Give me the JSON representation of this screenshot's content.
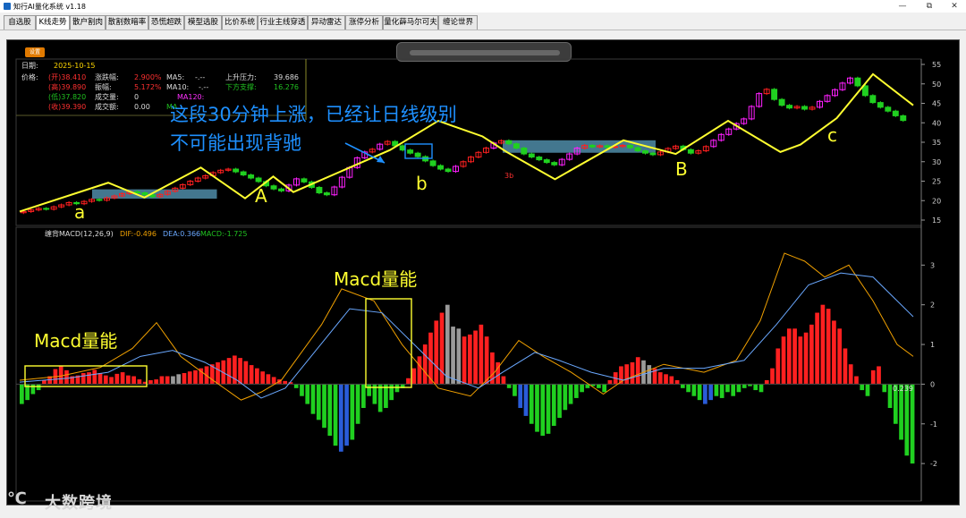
{
  "window": {
    "title": "知行AI量化系统 v1.18",
    "btn_min": "—",
    "btn_max": "⧉",
    "btn_close": "✕"
  },
  "tabs": [
    "自选股",
    "K线走势",
    "散户割肉",
    "散割数暗率",
    "恐慌超跌",
    "模型选股",
    "比价系统",
    "行业主线穿透",
    "异动雷达",
    "涨停分析",
    "量化薛马尔可夫",
    "缠论世界"
  ],
  "toolbar": {
    "settings_label": "设置"
  },
  "info": {
    "date_label": "日期:",
    "date_value": "2025-10-15",
    "price_label": "价格:",
    "open": "(开)38.410",
    "high": "(高)39.890",
    "low": "(低)37.820",
    "close": "(收)39.390",
    "change_pct_label": "涨跌幅:",
    "change_pct": "2.900%",
    "amplitude_label": "振幅:",
    "amplitude": "5.172%",
    "volume_label": "成交量:",
    "volume": "0",
    "amount_label": "成交额:",
    "amount": "0.00",
    "ma5_label": "MA5:",
    "ma5": "-.--",
    "ma10_label": "MA10:",
    "ma10": "-.--",
    "ma120_label": "MA120:",
    "ma_label": "MA",
    "resistance_label": "上升压力:",
    "resistance": "39.686",
    "support_label": "下方支撑:",
    "support": "16.276"
  },
  "macd_header": {
    "name": "缠背MACD(12,26,9)",
    "dif": "DIF:-0.496",
    "dea": "DEA:0.366",
    "macd": "MACD:-1.725"
  },
  "annotations": {
    "main_text_1": "这段30分钟上涨，已经让日线级别",
    "main_text_2": "不可能出现背驰",
    "label_a": "a",
    "label_A": "A",
    "label_b": "b",
    "label_B": "B",
    "label_c": "c",
    "macd_label_1": "Macd量能",
    "macd_label_2": "Macd量能",
    "zero_value": "0.239",
    "bottom_mark": "3b"
  },
  "price_axis": [
    "55",
    "50",
    "45",
    "40",
    "35",
    "30",
    "25",
    "20",
    "15"
  ],
  "macd_axis": [
    "3",
    "2",
    "1",
    "0",
    "-1",
    "-2"
  ],
  "watermark": {
    "icon": "℃",
    "text": "大数跨境"
  },
  "colors": {
    "up": "#ff2020",
    "down": "#20d020",
    "magenta": "#ff20ff",
    "zigzag": "#ffff30",
    "zone": "#4f8ca8",
    "annot": "#1e90ff",
    "dif": "#f0a000",
    "dea": "#6aa8ff"
  },
  "chart_data": {
    "type": "candlestick+macd",
    "price": {
      "ylim": [
        15,
        55
      ],
      "closes": [
        17.2,
        17.6,
        18.0,
        17.8,
        18.4,
        18.9,
        19.5,
        19.2,
        19.8,
        20.3,
        20.1,
        20.7,
        21.2,
        21.8,
        22.3,
        22.0,
        21.5,
        21.0,
        21.6,
        22.4,
        23.2,
        24.1,
        25.0,
        25.8,
        26.4,
        27.2,
        27.8,
        28.1,
        27.4,
        26.6,
        25.8,
        24.9,
        23.8,
        23.0,
        22.5,
        24.0,
        25.6,
        24.8,
        23.4,
        22.0,
        21.5,
        23.5,
        26.0,
        28.5,
        31.0,
        32.5,
        33.2,
        34.5,
        35.2,
        34.1,
        33.0,
        32.2,
        31.3,
        30.2,
        29.0,
        28.1,
        27.5,
        28.8,
        30.0,
        31.2,
        32.4,
        33.5,
        34.8,
        35.4,
        34.6,
        33.5,
        32.0,
        31.2,
        30.5,
        29.8,
        29.2,
        30.6,
        32.0,
        33.5,
        34.2,
        33.8,
        34.1,
        33.7,
        33.9,
        34.2,
        33.6,
        32.8,
        32.2,
        31.8,
        32.5,
        33.4,
        34.0,
        33.1,
        32.2,
        32.8,
        33.9,
        35.5,
        37.0,
        38.4,
        39.8,
        41.0,
        44.2,
        47.5,
        48.6,
        46.0,
        44.5,
        43.8,
        44.2,
        43.5,
        44.0,
        45.5,
        47.0,
        48.5,
        50.2,
        51.5,
        49.5,
        47.0,
        45.2,
        44.0,
        43.0,
        41.8,
        40.6
      ],
      "zigzag": [
        [
          0,
          17.2
        ],
        [
          22,
          24.6
        ],
        [
          31,
          20.8
        ],
        [
          45,
          28.5
        ],
        [
          56,
          20.6
        ],
        [
          63,
          26.2
        ],
        [
          68,
          22.2
        ],
        [
          92,
          33.0
        ],
        [
          104,
          40.5
        ],
        [
          115,
          36.5
        ],
        [
          121,
          32.5
        ],
        [
          133,
          25.5
        ],
        [
          150,
          35.5
        ],
        [
          163,
          32.0
        ],
        [
          176,
          40.5
        ],
        [
          189,
          32.5
        ],
        [
          194,
          34.4
        ],
        [
          203,
          41.2
        ],
        [
          212,
          52.5
        ],
        [
          222,
          44.5
        ]
      ],
      "zones": [
        {
          "from": 18,
          "to": 49,
          "low": 20.5,
          "high": 22.9
        },
        {
          "from": 120,
          "to": 158,
          "low": 32.3,
          "high": 35.5
        }
      ]
    },
    "macd": {
      "ylim": [
        -2.2,
        3.3
      ],
      "hist": [
        -0.5,
        -0.4,
        -0.25,
        -0.15,
        0.1,
        0.2,
        0.38,
        0.45,
        0.35,
        0.2,
        0.22,
        0.28,
        0.3,
        0.36,
        0.28,
        0.22,
        0.18,
        0.26,
        0.3,
        0.22,
        0.2,
        0.12,
        0.06,
        0.1,
        0.12,
        0.2,
        0.2,
        0.2,
        0.25,
        0.28,
        0.32,
        0.35,
        0.4,
        0.45,
        0.5,
        0.55,
        0.6,
        0.66,
        0.72,
        0.66,
        0.58,
        0.48,
        0.4,
        0.32,
        0.25,
        0.18,
        0.12,
        0.08,
        0.05,
        -0.1,
        -0.3,
        -0.5,
        -0.75,
        -0.9,
        -1.1,
        -1.3,
        -1.55,
        -1.7,
        -1.55,
        -1.4,
        -1.0,
        -0.6,
        -0.3,
        -0.5,
        -0.7,
        -0.6,
        -0.4,
        -0.2,
        -0.1,
        0.15,
        0.4,
        0.7,
        1.0,
        1.3,
        1.6,
        1.8,
        2.0,
        1.45,
        1.4,
        1.2,
        1.25,
        1.35,
        1.5,
        1.2,
        0.8,
        0.55,
        0.2,
        -0.1,
        -0.3,
        -0.6,
        -0.8,
        -1.0,
        -1.2,
        -1.3,
        -1.25,
        -1.05,
        -0.85,
        -0.65,
        -0.5,
        -0.35,
        -0.2,
        -0.1,
        -0.05,
        -0.1,
        -0.2,
        0.1,
        0.3,
        0.45,
        0.5,
        0.55,
        0.68,
        0.6,
        0.48,
        0.4,
        0.3,
        0.25,
        0.2,
        0.1,
        -0.1,
        -0.2,
        -0.3,
        -0.4,
        -0.5,
        -0.4,
        -0.3,
        -0.35,
        -0.2,
        -0.3,
        -0.2,
        -0.1,
        -0.05,
        -0.15,
        -0.2,
        0.1,
        0.4,
        0.9,
        1.2,
        1.4,
        1.4,
        1.2,
        1.3,
        1.5,
        1.8,
        2.0,
        1.9,
        1.6,
        1.4,
        0.9,
        0.5,
        0.2,
        -0.15,
        -0.3,
        0.35,
        0.45,
        -0.2,
        -0.6,
        -1.0,
        -1.4,
        -1.8,
        -2.0
      ],
      "dif": [
        [
          0,
          0.1
        ],
        [
          10,
          0.2
        ],
        [
          20,
          0.42
        ],
        [
          28,
          0.9
        ],
        [
          34,
          1.55
        ],
        [
          40,
          0.7
        ],
        [
          48,
          0.1
        ],
        [
          55,
          -0.4
        ],
        [
          60,
          -0.2
        ],
        [
          65,
          0.1
        ],
        [
          75,
          1.5
        ],
        [
          80,
          2.4
        ],
        [
          88,
          2.1
        ],
        [
          95,
          1.0
        ],
        [
          104,
          -0.1
        ],
        [
          112,
          -0.3
        ],
        [
          118,
          0.3
        ],
        [
          124,
          1.1
        ],
        [
          130,
          0.7
        ],
        [
          137,
          0.3
        ],
        [
          145,
          -0.25
        ],
        [
          150,
          0.1
        ],
        [
          160,
          0.5
        ],
        [
          170,
          0.3
        ],
        [
          178,
          0.6
        ],
        [
          184,
          1.6
        ],
        [
          190,
          3.3
        ],
        [
          195,
          3.1
        ],
        [
          200,
          2.7
        ],
        [
          206,
          3.0
        ],
        [
          212,
          2.1
        ],
        [
          218,
          1.0
        ],
        [
          222,
          0.7
        ]
      ],
      "dea": [
        [
          0,
          0.05
        ],
        [
          12,
          0.15
        ],
        [
          22,
          0.3
        ],
        [
          30,
          0.7
        ],
        [
          38,
          0.85
        ],
        [
          46,
          0.55
        ],
        [
          54,
          0.1
        ],
        [
          60,
          -0.35
        ],
        [
          66,
          -0.1
        ],
        [
          74,
          0.9
        ],
        [
          82,
          1.9
        ],
        [
          90,
          1.8
        ],
        [
          98,
          1.0
        ],
        [
          106,
          0.2
        ],
        [
          114,
          -0.1
        ],
        [
          120,
          0.3
        ],
        [
          128,
          0.8
        ],
        [
          134,
          0.6
        ],
        [
          142,
          0.3
        ],
        [
          150,
          0.1
        ],
        [
          160,
          0.4
        ],
        [
          170,
          0.4
        ],
        [
          180,
          0.6
        ],
        [
          188,
          1.5
        ],
        [
          196,
          2.5
        ],
        [
          204,
          2.8
        ],
        [
          212,
          2.7
        ],
        [
          218,
          2.1
        ],
        [
          222,
          1.7
        ]
      ]
    }
  }
}
